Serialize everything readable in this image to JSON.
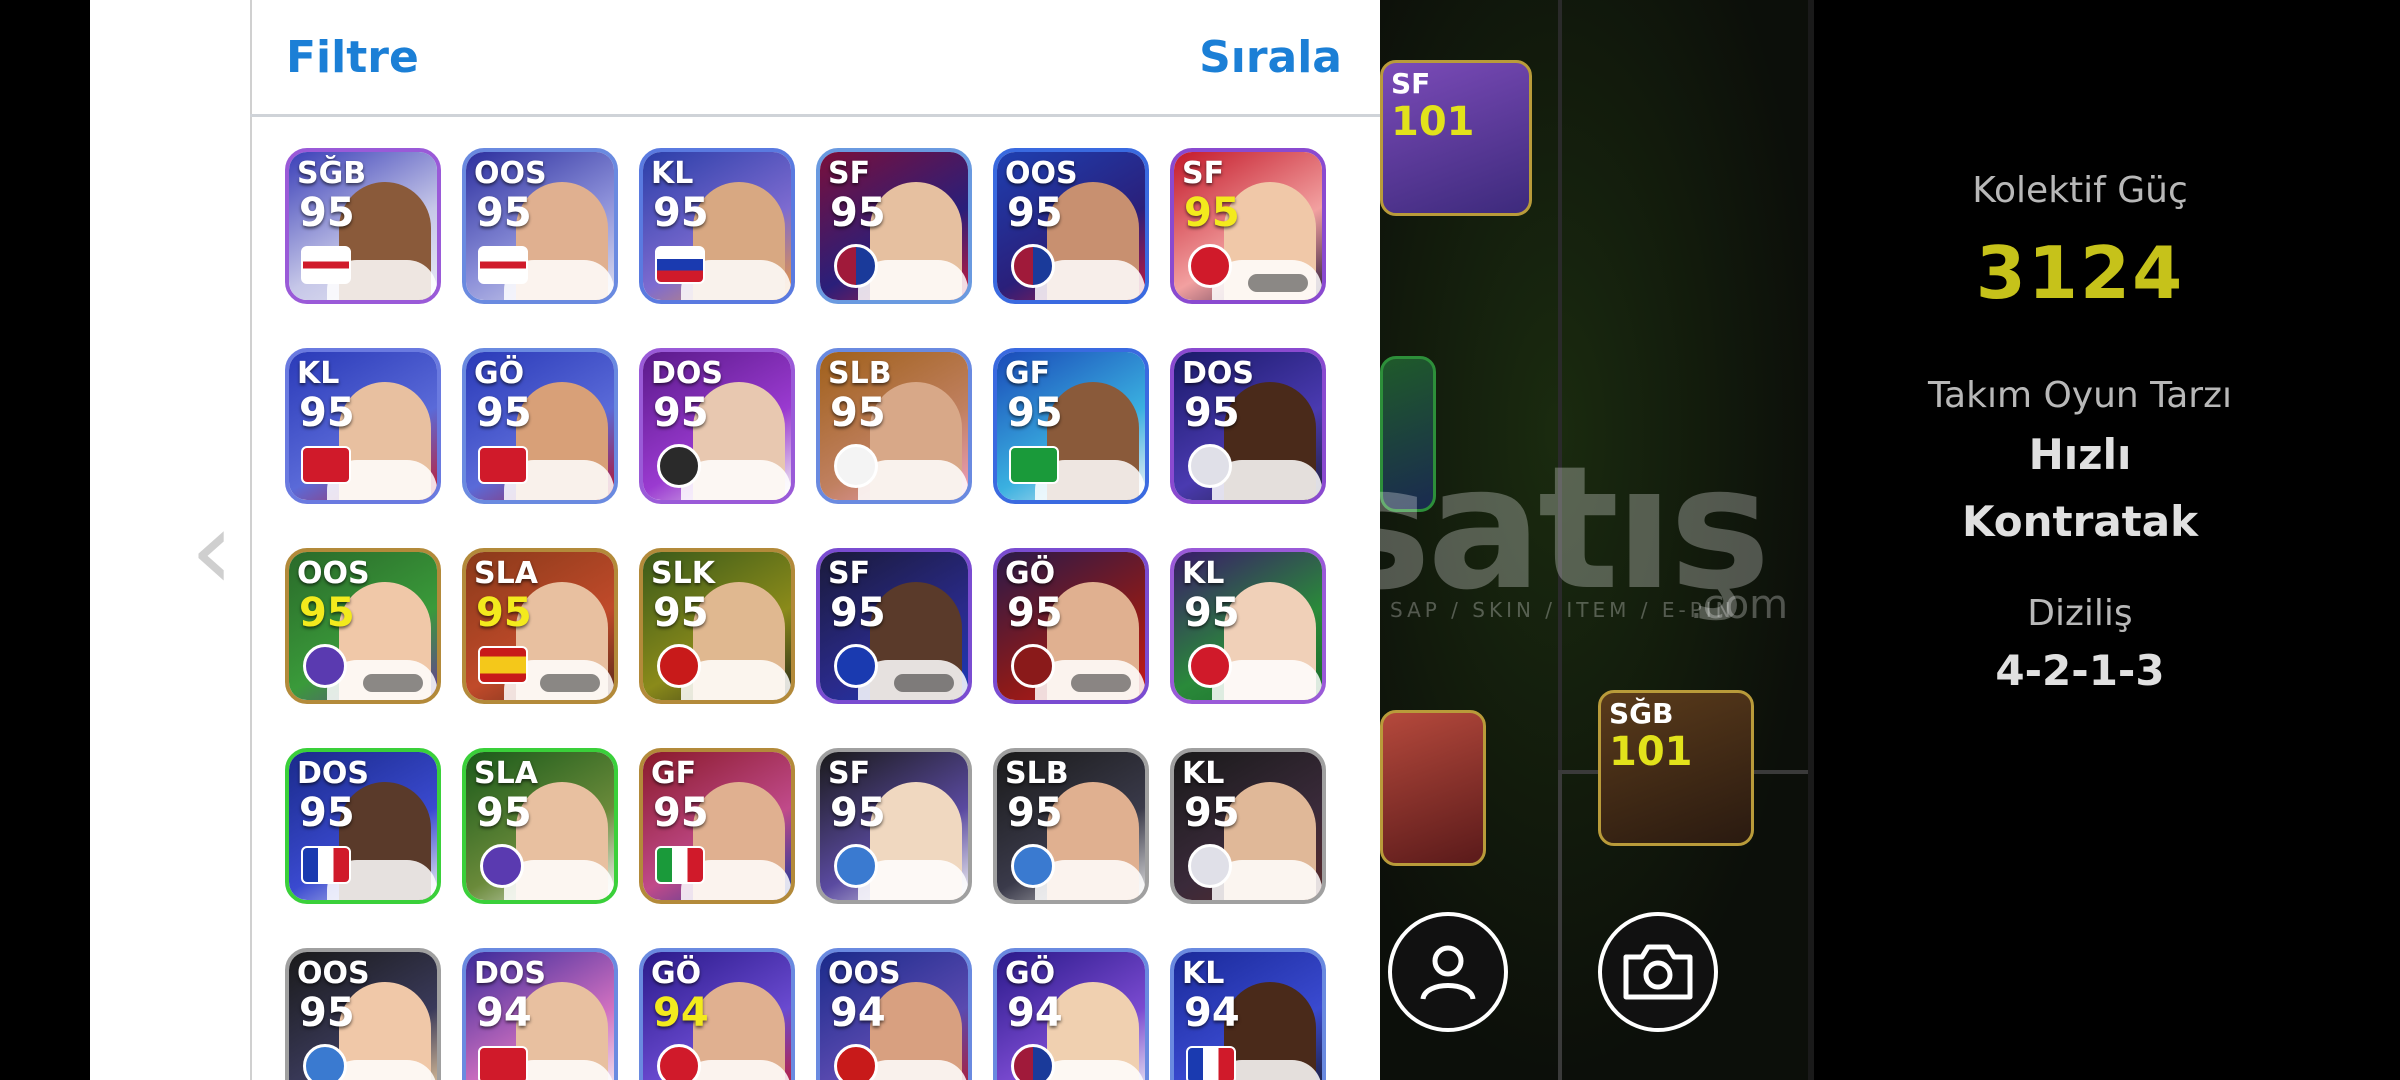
{
  "header": {
    "filter_label": "Filtre",
    "sort_label": "Sırala"
  },
  "stats": {
    "collective_label": "Kolektif Güç",
    "collective_value": "3124",
    "style_label": "Takım Oyun Tarzı",
    "style_value_1": "Hızlı",
    "style_value_2": "Kontratak",
    "formation_label": "Diziliş",
    "formation_value": "4-2-1-3"
  },
  "watermark": {
    "main": "satış",
    "sub": "SAP / SKIN / ITEM / E-PIN",
    "com": ".com"
  },
  "pitch_cards": [
    {
      "pos": "SF",
      "rating": "101"
    },
    {
      "pos": "SĞB",
      "rating": "101"
    }
  ],
  "cards": [
    {
      "pos": "SĞB",
      "rating": "95",
      "emblem": "flag-england"
    },
    {
      "pos": "OOS",
      "rating": "95",
      "emblem": "flag-england"
    },
    {
      "pos": "KL",
      "rating": "95",
      "emblem": "flag-slovenia"
    },
    {
      "pos": "SF",
      "rating": "95",
      "emblem": "club-barcelona"
    },
    {
      "pos": "OOS",
      "rating": "95",
      "emblem": "club-barcelona"
    },
    {
      "pos": "SF",
      "rating": "95",
      "emblem": "club-bayern"
    },
    {
      "pos": "KL",
      "rating": "95",
      "emblem": "flag-switzerland"
    },
    {
      "pos": "GÖ",
      "rating": "95",
      "emblem": "flag-turkey"
    },
    {
      "pos": "DOS",
      "rating": "95",
      "emblem": "club-dark"
    },
    {
      "pos": "SLB",
      "rating": "95",
      "emblem": "club-saopaulo"
    },
    {
      "pos": "GF",
      "rating": "95",
      "emblem": "flag-brazil"
    },
    {
      "pos": "DOS",
      "rating": "95",
      "emblem": "club-white"
    },
    {
      "pos": "OOS",
      "rating": "95",
      "emblem": "club-purple"
    },
    {
      "pos": "SLA",
      "rating": "95",
      "emblem": "flag-spain"
    },
    {
      "pos": "SLK",
      "rating": "95",
      "emblem": "club-manutd"
    },
    {
      "pos": "SF",
      "rating": "95",
      "emblem": "club-inter"
    },
    {
      "pos": "GÖ",
      "rating": "95",
      "emblem": "club-red"
    },
    {
      "pos": "KL",
      "rating": "95",
      "emblem": "club-bayern"
    },
    {
      "pos": "DOS",
      "rating": "95",
      "emblem": "flag-france"
    },
    {
      "pos": "SLA",
      "rating": "95",
      "emblem": "club-purple"
    },
    {
      "pos": "GF",
      "rating": "95",
      "emblem": "flag-italy"
    },
    {
      "pos": "SF",
      "rating": "95",
      "emblem": "club-blue"
    },
    {
      "pos": "SLB",
      "rating": "95",
      "emblem": "club-blue"
    },
    {
      "pos": "KL",
      "rating": "95",
      "emblem": "club-white"
    },
    {
      "pos": "OOS",
      "rating": "95",
      "emblem": "club-blue"
    },
    {
      "pos": "DOS",
      "rating": "94",
      "emblem": "flag-switzerland"
    },
    {
      "pos": "GÖ",
      "rating": "94",
      "emblem": "club-bayern"
    },
    {
      "pos": "OOS",
      "rating": "94",
      "emblem": "club-manutd"
    },
    {
      "pos": "GÖ",
      "rating": "94",
      "emblem": "club-barcelona"
    },
    {
      "pos": "KL",
      "rating": "94",
      "emblem": "flag-france"
    }
  ],
  "icons": {
    "back": "chevron-left-icon",
    "avatar": "user-icon",
    "camera": "camera-icon"
  },
  "colors": {
    "accent": "#1b7fd6",
    "collective": "#c6c21a",
    "navy": "#050b6e"
  }
}
